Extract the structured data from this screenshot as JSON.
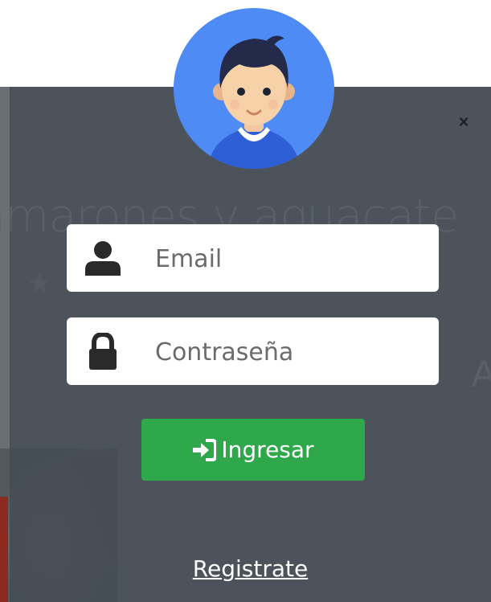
{
  "background": {
    "title_fragment": "amarones y aguacate",
    "right_fragment": "A"
  },
  "modal": {
    "close_symbol": "×",
    "avatar_icon": "user-avatar-icon",
    "email": {
      "placeholder": "Email",
      "value": "",
      "icon": "user-icon"
    },
    "password": {
      "placeholder": "Contraseña",
      "value": "",
      "icon": "lock-icon"
    },
    "login_button": {
      "label": "Ingresar",
      "icon": "sign-in-icon",
      "color": "#2ea84a"
    },
    "register_link": "Registrate"
  },
  "colors": {
    "overlay": "#464d55",
    "avatar_background": "#4f8bf5",
    "button": "#2ea84a"
  }
}
